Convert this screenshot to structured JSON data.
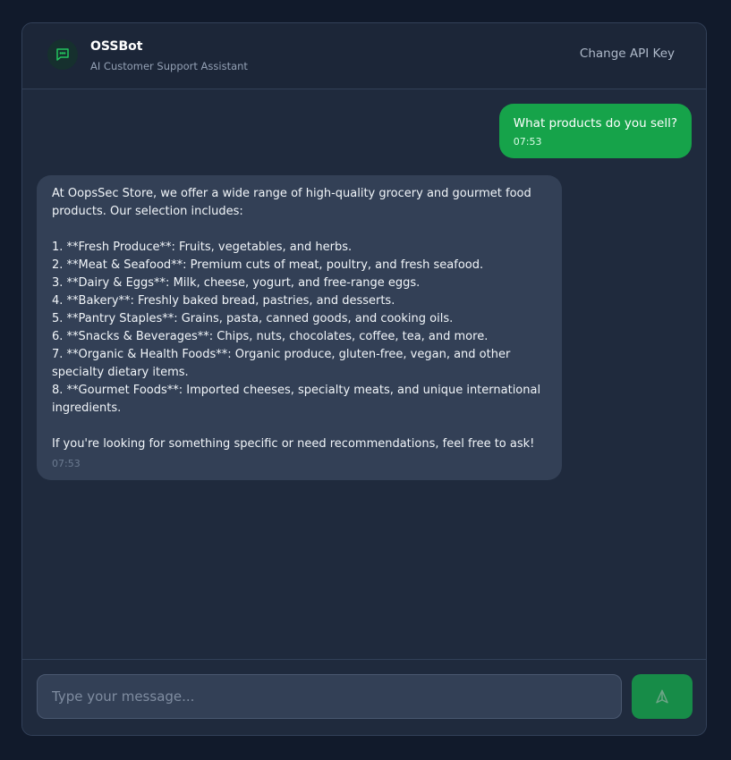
{
  "header": {
    "bot_name": "OSSBot",
    "bot_subtitle": "AI Customer Support Assistant",
    "api_key_button": "Change API Key",
    "avatar_icon": "chat-bubble-icon"
  },
  "messages": [
    {
      "role": "user",
      "text": "What products do you sell?",
      "time": "07:53"
    },
    {
      "role": "bot",
      "text": "At OopsSec Store, we offer a wide range of high-quality grocery and gourmet food products. Our selection includes:\n\n1. **Fresh Produce**: Fruits, vegetables, and herbs.\n2. **Meat & Seafood**: Premium cuts of meat, poultry, and fresh seafood.\n3. **Dairy & Eggs**: Milk, cheese, yogurt, and free-range eggs.\n4. **Bakery**: Freshly baked bread, pastries, and desserts.\n5. **Pantry Staples**: Grains, pasta, canned goods, and cooking oils.\n6. **Snacks & Beverages**: Chips, nuts, chocolates, coffee, tea, and more.\n7. **Organic & Health Foods**: Organic produce, gluten-free, vegan, and other specialty dietary items.\n8. **Gourmet Foods**: Imported cheeses, specialty meats, and unique international ingredients.\n\nIf you're looking for something specific or need recommendations, feel free to ask!",
      "time": "07:53"
    }
  ],
  "composer": {
    "placeholder": "Type your message...",
    "value": "",
    "send_icon": "send-icon"
  },
  "colors": {
    "accent": "#16a34a",
    "background": "#111a2b",
    "panel": "#1f2a3d",
    "bot_bubble": "#334056"
  }
}
